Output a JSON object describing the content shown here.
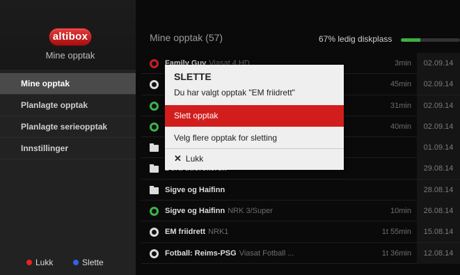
{
  "sidebar": {
    "logo": "altibox",
    "title": "Mine opptak",
    "items": [
      {
        "label": "Mine opptak",
        "active": true
      },
      {
        "label": "Planlagte opptak",
        "active": false
      },
      {
        "label": "Planlagte serieopptak",
        "active": false
      },
      {
        "label": "Innstillinger",
        "active": false
      }
    ],
    "legend": {
      "close": "Lukk",
      "delete": "Slette",
      "close_color": "#ee2222",
      "delete_color": "#2f62e8"
    }
  },
  "main": {
    "header": "Mine opptak (57)",
    "disk_label": "67% ledig diskplass",
    "disk_free": 0.67,
    "rows": [
      {
        "icon": "record-red-icon",
        "title": "Family Guy",
        "channel": "Viasat 4 HD",
        "duration": "3min",
        "date": "02.09.14"
      },
      {
        "icon": "record-icon",
        "title": "",
        "channel": "",
        "duration": "45min",
        "date": "02.09.14"
      },
      {
        "icon": "record-green-icon",
        "title": "",
        "channel": "",
        "duration": "31min",
        "date": "02.09.14"
      },
      {
        "icon": "record-green-icon",
        "title": "",
        "channel": "",
        "duration": "40min",
        "date": "02.09.14"
      },
      {
        "icon": "folder-icon",
        "title": "",
        "channel": "",
        "duration": "",
        "date": "01.09.14"
      },
      {
        "icon": "folder-icon",
        "title": "Dora utforskeren",
        "channel": "",
        "duration": "",
        "date": "29.08.14"
      },
      {
        "icon": "folder-icon",
        "title": "Sigve og Haifinn",
        "channel": "",
        "duration": "",
        "date": "28.08.14"
      },
      {
        "icon": "record-green-icon",
        "title": "Sigve og Haifinn",
        "channel": "NRK 3/Super",
        "duration": "10min",
        "date": "26.08.14"
      },
      {
        "icon": "record-icon",
        "title": "EM friidrett",
        "channel": "NRK1",
        "duration": "1t 55min",
        "date": "15.08.14"
      },
      {
        "icon": "record-icon",
        "title": "Fotball: Reims-PSG",
        "channel": "Viasat Fotball ...",
        "duration": "1t 36min",
        "date": "12.08.14"
      }
    ]
  },
  "dialog": {
    "title": "SLETTE",
    "message": "Du har valgt opptak \"EM friidrett\"",
    "options": {
      "delete": "Slett opptak",
      "select_more": "Velg flere opptak for sletting",
      "close": "Lukk"
    },
    "close_symbol": "✕"
  }
}
